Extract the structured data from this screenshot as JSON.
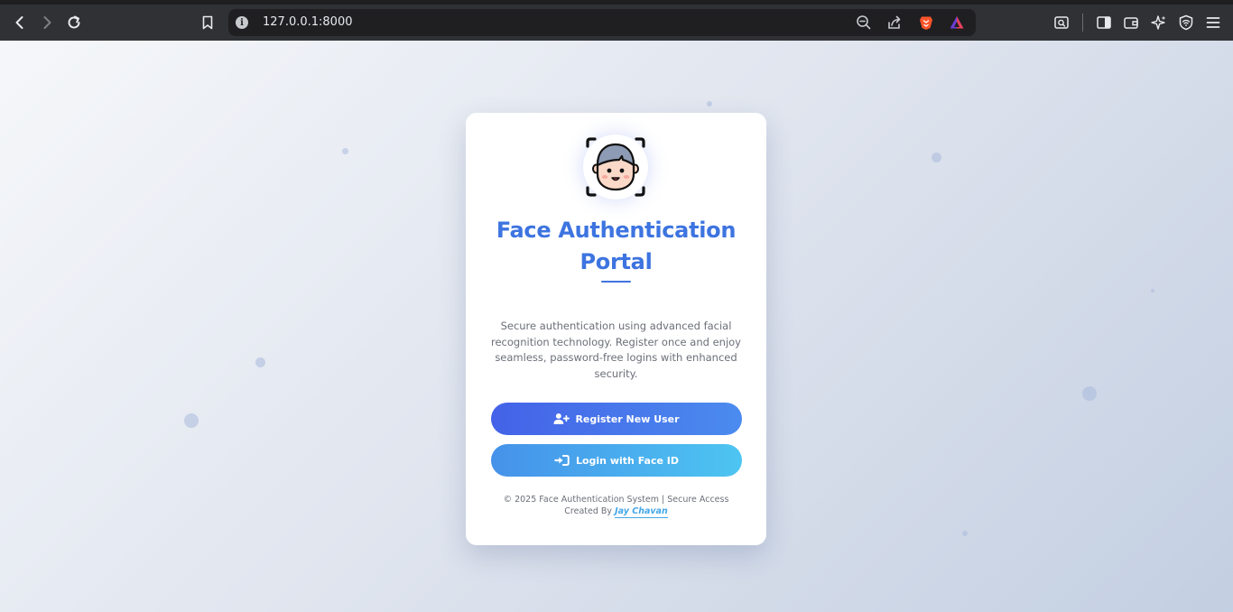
{
  "browser": {
    "url": "127.0.0.1:8000",
    "info_glyph": "i",
    "icons": {
      "back": "back-arrow-icon",
      "forward": "forward-arrow-icon",
      "reload": "reload-icon",
      "bookmark": "bookmark-icon",
      "zoom": "zoom-out-icon",
      "share": "share-icon",
      "brave_shields": "brave-lion-icon",
      "brave_rewards": "brave-rewards-icon",
      "page_search": "page-search-icon",
      "sidebar": "sidebar-icon",
      "wallet": "wallet-icon",
      "leo": "leo-ai-icon",
      "vpn": "vpn-shield-icon",
      "menu": "hamburger-menu-icon"
    }
  },
  "card": {
    "logo_icon": "face-scan-icon",
    "title": "Face Authentication Portal",
    "description": "Secure authentication using advanced facial recognition technology. Register once and enjoy seamless, password-free logins with enhanced security.",
    "register_label": "Register New User",
    "register_icon": "user-plus-icon",
    "login_label": "Login with Face ID",
    "login_icon": "sign-in-icon",
    "footer_text": "© 2025 Face Authentication System | Secure Access",
    "created_by": "Created By",
    "author": "Jay Chavan"
  },
  "colors": {
    "title": "#3d74e0",
    "register_gradient": [
      "#4462e8",
      "#4b8bee"
    ],
    "login_gradient": [
      "#4592ea",
      "#4dc5f1"
    ],
    "author_link": "#43a6e8"
  }
}
